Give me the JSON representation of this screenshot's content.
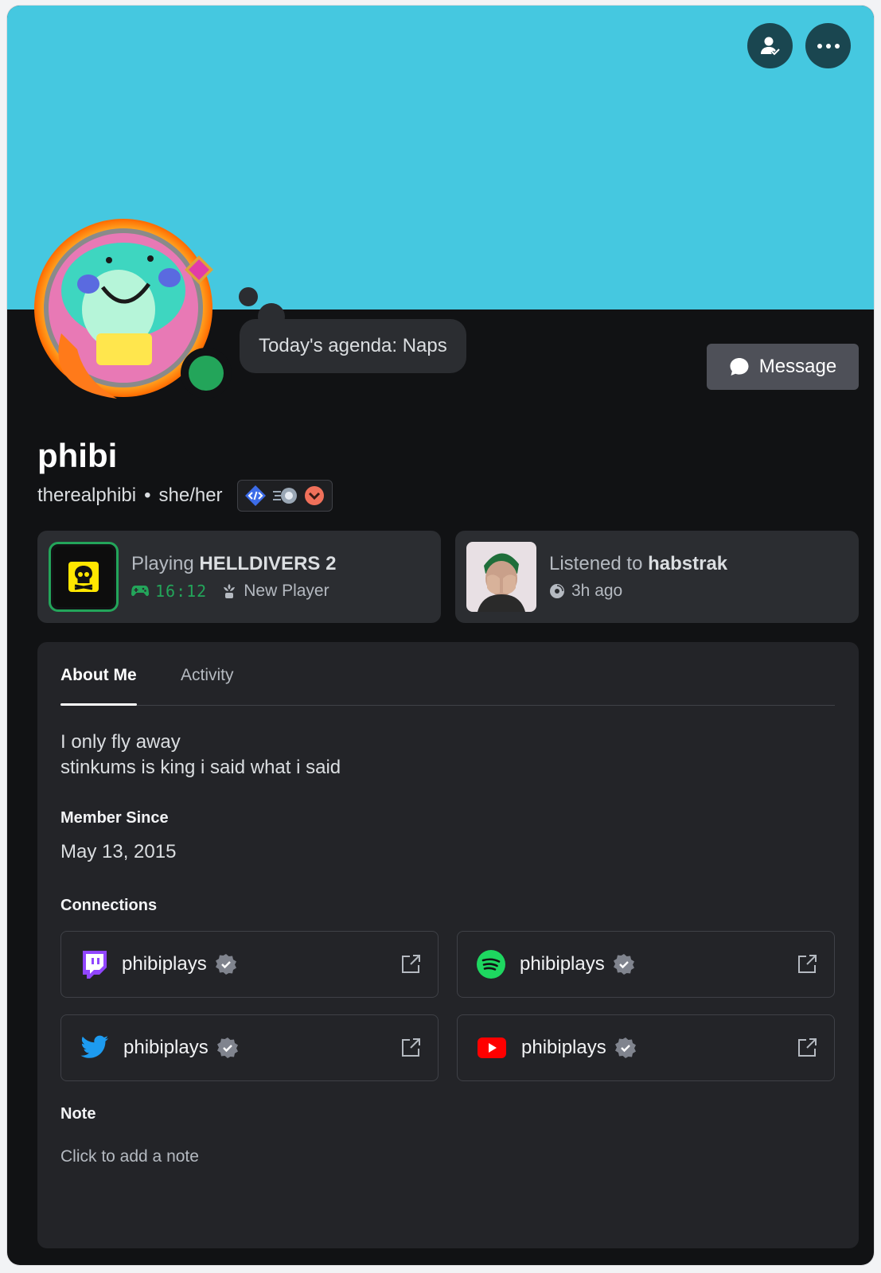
{
  "header": {
    "friend_button_icon": "friend-check-icon",
    "more_button_icon": "more-dots-icon",
    "banner_color": "#45c8e0"
  },
  "profile": {
    "status_bubble": "Today's agenda: Naps",
    "message_label": "Message",
    "display_name": "phibi",
    "username": "therealphibi",
    "separator": "•",
    "pronouns": "she/her",
    "status_color": "#23a55a",
    "badges": [
      "active-developer-badge",
      "boost-badge",
      "quest-badge"
    ]
  },
  "activity": {
    "game": {
      "prefix": "Playing",
      "name": "HELLDIVERS 2",
      "elapsed": "16:12",
      "rank": "New Player"
    },
    "music": {
      "prefix": "Listened to",
      "artist": "habstrak",
      "when": "3h ago"
    }
  },
  "tabs": [
    {
      "label": "About Me",
      "active": true
    },
    {
      "label": "Activity",
      "active": false
    }
  ],
  "about": {
    "bio_line1": "I only fly away",
    "bio_line2": "stinkums is king i said what i said",
    "member_since_label": "Member Since",
    "member_since": "May 13, 2015",
    "connections_label": "Connections",
    "connections": [
      {
        "service": "twitch",
        "name": "phibiplays",
        "verified": true
      },
      {
        "service": "spotify",
        "name": "phibiplays",
        "verified": true
      },
      {
        "service": "twitter",
        "name": "phibiplays",
        "verified": true
      },
      {
        "service": "youtube",
        "name": "phibiplays",
        "verified": true
      }
    ],
    "note_label": "Note",
    "note_placeholder": "Click to add a note"
  }
}
